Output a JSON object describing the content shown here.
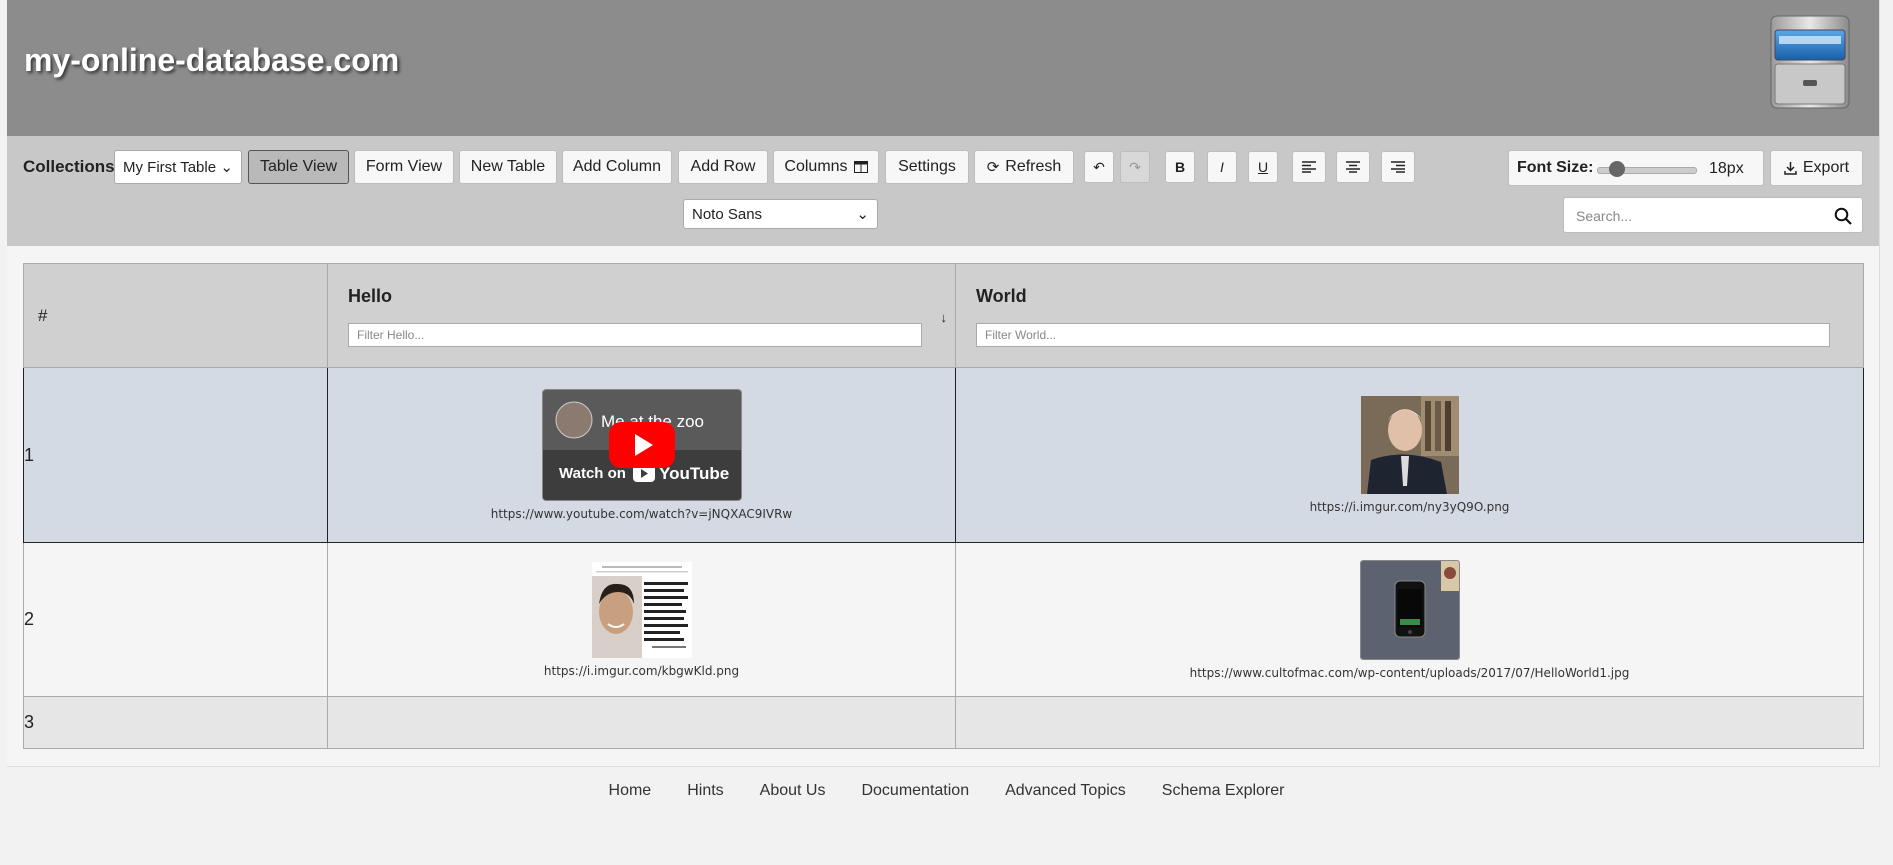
{
  "header": {
    "site_title": "my-online-database.com"
  },
  "toolbar": {
    "collections_label": "Collections:",
    "collection_selected": "My First Table",
    "buttons": {
      "table_view": "Table View",
      "form_view": "Form View",
      "new_table": "New Table",
      "add_column": "Add Column",
      "add_row": "Add Row",
      "columns": "Columns",
      "settings": "Settings",
      "refresh": "Refresh",
      "bold": "B",
      "italic": "I",
      "underline": "U"
    },
    "font_family_selected": "Noto Sans",
    "font_size_label": "Font Size:",
    "font_size_value": "18px",
    "font_size_fraction": 0.2,
    "export_label": "Export",
    "search_placeholder": "Search..."
  },
  "table": {
    "hash_header": "#",
    "columns": [
      {
        "title": "Hello",
        "filter_placeholder": "Filter Hello...",
        "sort_indicator": "↓"
      },
      {
        "title": "World",
        "filter_placeholder": "Filter World..."
      }
    ],
    "rows": [
      {
        "num": "1",
        "hello": {
          "video_title": "Me at the zoo",
          "video_watch": "Watch on",
          "video_brand": "YouTube",
          "url": "https://www.youtube.com/watch?v=jNQXAC9IVRw"
        },
        "world": {
          "url": "https://i.imgur.com/ny3yQ9O.png"
        }
      },
      {
        "num": "2",
        "hello": {
          "url": "https://i.imgur.com/kbgwKld.png"
        },
        "world": {
          "url": "https://www.cultofmac.com/wp-content/uploads/2017/07/HelloWorld1.jpg"
        }
      },
      {
        "num": "3",
        "hello": {
          "url": ""
        },
        "world": {
          "url": ""
        }
      }
    ]
  },
  "footer": {
    "links": [
      "Home",
      "Hints",
      "About Us",
      "Documentation",
      "Advanced Topics",
      "Schema Explorer"
    ]
  },
  "colors": {
    "header_bg": "#8c8c8c",
    "toolbar_bg": "#c8c8c8",
    "selected_row": "#d4dae4",
    "youtube_red": "#ff0000"
  }
}
